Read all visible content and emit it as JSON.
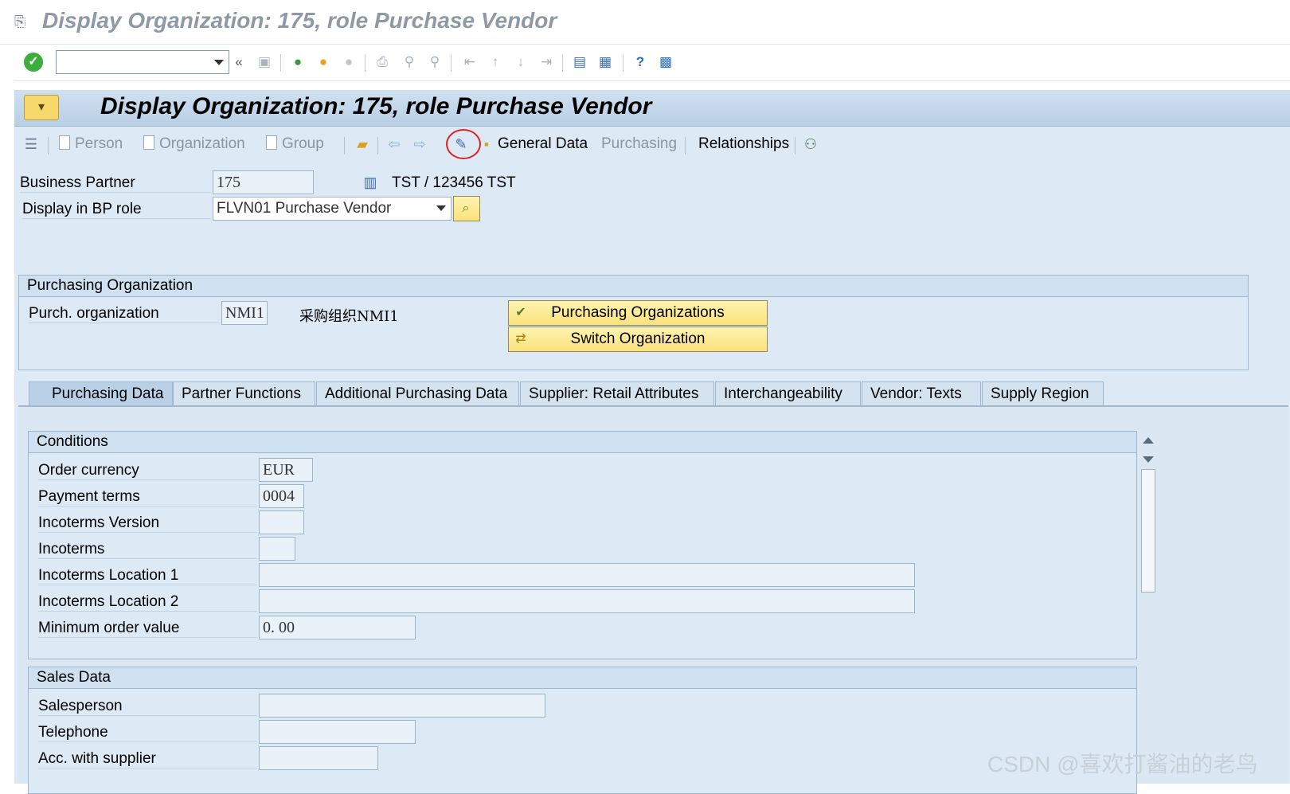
{
  "window": {
    "title": "Display Organization: 175, role Purchase Vendor"
  },
  "system_toolbar": {
    "command_field_value": "",
    "icons": [
      "enter-icon",
      "command-dropdown",
      "collapse-icon",
      "save-icon",
      "back-icon",
      "exit-icon",
      "cancel-icon",
      "print-icon",
      "find-icon",
      "find-next-icon",
      "first-page-icon",
      "prev-page-icon",
      "next-page-icon",
      "last-page-icon",
      "new-session-icon",
      "shortcut-icon",
      "help-icon",
      "customize-layout-icon"
    ]
  },
  "app": {
    "title": "Display Organization: 175, role Purchase Vendor",
    "toolbar": {
      "person": "Person",
      "organization": "Organization",
      "group": "Group",
      "general_data": "General Data",
      "purchasing": "Purchasing",
      "relationships": "Relationships"
    }
  },
  "header": {
    "business_partner_label": "Business Partner",
    "business_partner_value": "175",
    "bp_description": "TST / 123456 TST",
    "display_in_bp_role_label": "Display in BP role",
    "display_in_bp_role_value": "FLVN01 Purchase Vendor"
  },
  "purchasing_org": {
    "group_title": "Purchasing Organization",
    "label": "Purch. organization",
    "value": "NMI1",
    "description": "采购组织NMI1",
    "btn_purchasing_orgs": "Purchasing Organizations",
    "btn_switch_org": "Switch Organization"
  },
  "tabs": [
    {
      "label": "Purchasing Data"
    },
    {
      "label": "Partner Functions"
    },
    {
      "label": "Additional Purchasing Data"
    },
    {
      "label": "Supplier: Retail Attributes"
    },
    {
      "label": "Interchangeability"
    },
    {
      "label": "Vendor: Texts"
    },
    {
      "label": "Supply Region"
    }
  ],
  "active_tab": "Purchasing Data",
  "conditions": {
    "group_title": "Conditions",
    "order_currency_label": "Order currency",
    "order_currency_value": "EUR",
    "payment_terms_label": "Payment terms",
    "payment_terms_value": "0004",
    "incoterms_version_label": "Incoterms Version",
    "incoterms_version_value": "",
    "incoterms_label": "Incoterms",
    "incoterms_value": "",
    "incoterms_loc1_label": "Incoterms Location 1",
    "incoterms_loc1_value": "",
    "incoterms_loc2_label": "Incoterms Location 2",
    "incoterms_loc2_value": "",
    "min_order_value_label": "Minimum order value",
    "min_order_value_value": "0. 00"
  },
  "sales_data": {
    "group_title": "Sales Data",
    "salesperson_label": "Salesperson",
    "salesperson_value": "",
    "telephone_label": "Telephone",
    "telephone_value": "",
    "acc_with_supplier_label": "Acc. with supplier",
    "acc_with_supplier_value": ""
  },
  "watermark": "CSDN @喜欢打酱油的老鸟"
}
